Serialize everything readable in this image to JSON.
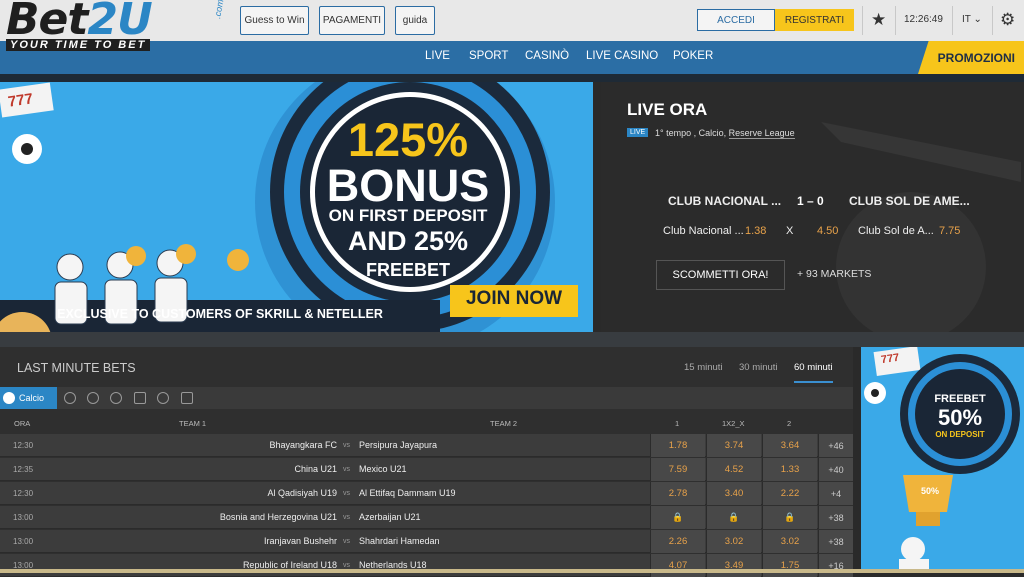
{
  "brand": {
    "name_a": "Bet",
    "name_b": "2U",
    "com": ".com",
    "tagline": "YOUR TIME TO BET"
  },
  "topnav": {
    "buttons": [
      "Guess to Win",
      "PAGAMENTI",
      "guida"
    ],
    "login": "ACCEDI",
    "register": "REGISTRATI",
    "clock": "12:26:49",
    "language": "IT"
  },
  "nav": {
    "items": [
      "LIVE",
      "SPORT",
      "CASINÒ",
      "LIVE CASINO",
      "POKER"
    ],
    "promo": "PROMOZIONI"
  },
  "banner": {
    "headline": "125%",
    "line2": "BONUS",
    "line3": "ON FIRST DEPOSIT",
    "line4": "AND 25%",
    "line5": "FREEBET",
    "cta": "JOIN NOW",
    "footer": "EXCLUSIVE TO CUSTOMERS OF SKRILL & NETELLER",
    "slot": "777"
  },
  "live": {
    "title": "LIVE ORA",
    "badge": "LIVE",
    "sub_a": "1° tempo , Calcio, ",
    "sub_b": "Reserve League",
    "team1": "CLUB NACIONAL ...",
    "team2": "CLUB SOL DE AME...",
    "score": "1 – 0",
    "odd1_label": "Club Nacional ...",
    "odd1": "1.38",
    "oddx_label": "X",
    "oddx": "4.50",
    "odd2_label": "Club Sol de A...",
    "odd2": "7.75",
    "bet_button": "SCOMMETTI ORA!",
    "markets": "+ 93 MARKETS"
  },
  "lastminute": {
    "title": "LAST MINUTE BETS",
    "tabs": [
      "15 minuti",
      "30 minuti",
      "60 minuti"
    ],
    "active_sport": "Calcio",
    "headers": {
      "time": "ORA",
      "team1": "TEAM 1",
      "team2": "TEAM 2",
      "o1": "1",
      "ox": "1X2_X",
      "o2": "2"
    },
    "vs": "vs",
    "rows": [
      {
        "time": "12:30",
        "t1": "Bhayangkara FC",
        "t2": "Persipura Jayapura",
        "o1": "1.78",
        "ox": "3.74",
        "o2": "3.64",
        "more": "+46"
      },
      {
        "time": "12:35",
        "t1": "China U21",
        "t2": "Mexico U21",
        "o1": "7.59",
        "ox": "4.52",
        "o2": "1.33",
        "more": "+40"
      },
      {
        "time": "12:30",
        "t1": "Al Qadisiyah U19",
        "t2": "Al Ettifaq Dammam U19",
        "o1": "2.78",
        "ox": "3.40",
        "o2": "2.22",
        "more": "+4"
      },
      {
        "time": "13:00",
        "t1": "Bosnia and Herzegovina U21",
        "t2": "Azerbaijan U21",
        "o1": "🔒",
        "ox": "🔒",
        "o2": "🔒",
        "more": "+38"
      },
      {
        "time": "13:00",
        "t1": "Iranjavan Bushehr",
        "t2": "Shahrdari Hamedan",
        "o1": "2.26",
        "ox": "3.02",
        "o2": "3.02",
        "more": "+38"
      },
      {
        "time": "13:00",
        "t1": "Republic of Ireland U18",
        "t2": "Netherlands U18",
        "o1": "4.07",
        "ox": "3.49",
        "o2": "1.75",
        "more": "+16"
      }
    ]
  },
  "side_banner": {
    "line1": "FREEBET",
    "line2": "50%",
    "line3": "ON DEPOSIT",
    "cup": "50%",
    "slot": "777"
  }
}
